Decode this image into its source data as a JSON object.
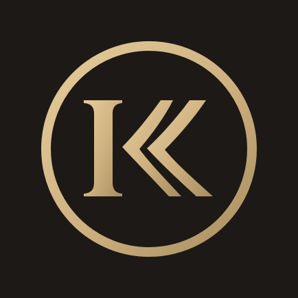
{
  "app_icon": {
    "logo_text": "KK",
    "icon_name": "kk-monogram-logo-icon",
    "colors": {
      "background": "#1d1916",
      "gold_light": "#e6cc9c",
      "gold_mid": "#cdb07e",
      "gold_dark": "#a88d5e"
    }
  }
}
